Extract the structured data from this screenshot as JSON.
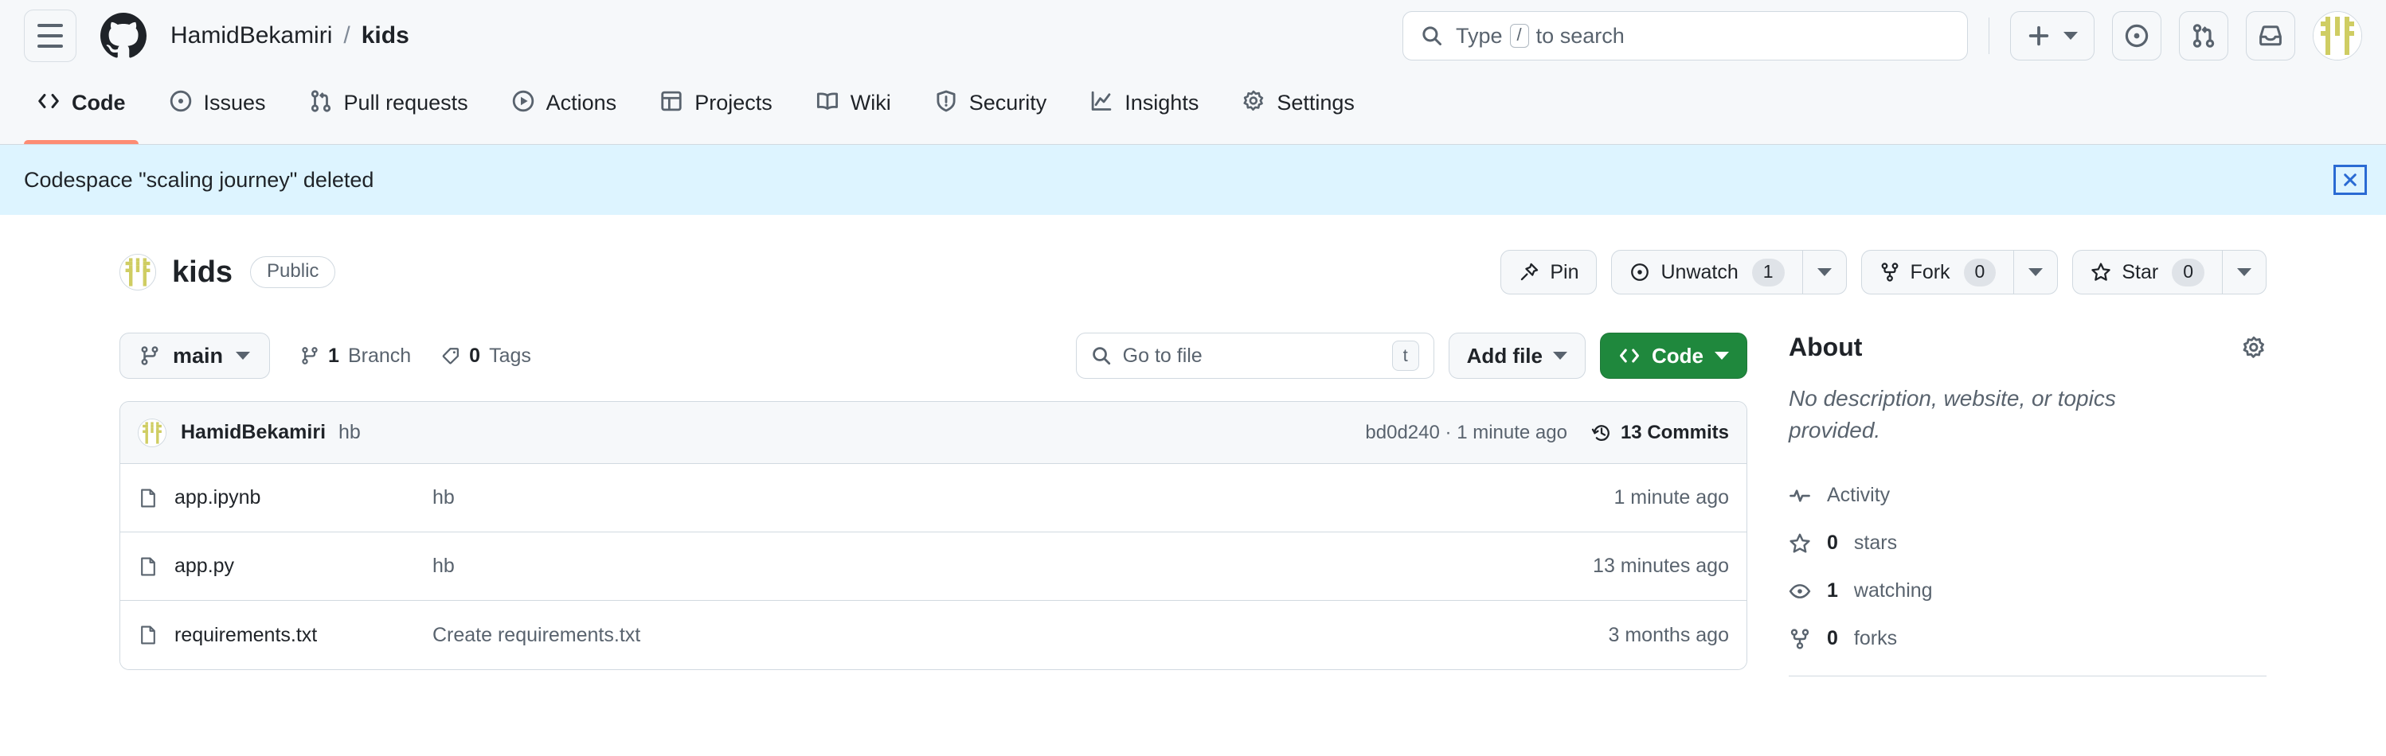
{
  "header": {
    "menu_label": "Open global navigation menu",
    "logo_name": "github-logo",
    "owner": "HamidBekamiri",
    "separator": "/",
    "repo": "kids",
    "search": {
      "placeholder_prefix": "Type",
      "slash_key": "/",
      "placeholder_suffix": "to search"
    },
    "create_new_label": "+",
    "icons": {
      "issues": "issue-opened-icon",
      "pull_requests": "git-pull-request-icon",
      "inbox": "inbox-icon",
      "avatar": "user-avatar"
    }
  },
  "nav": {
    "tabs": [
      {
        "label": "Code",
        "icon": "code-icon",
        "active": true
      },
      {
        "label": "Issues",
        "icon": "issue-opened-icon",
        "active": false
      },
      {
        "label": "Pull requests",
        "icon": "git-pull-request-icon",
        "active": false
      },
      {
        "label": "Actions",
        "icon": "play-icon",
        "active": false
      },
      {
        "label": "Projects",
        "icon": "table-icon",
        "active": false
      },
      {
        "label": "Wiki",
        "icon": "book-icon",
        "active": false
      },
      {
        "label": "Security",
        "icon": "shield-icon",
        "active": false
      },
      {
        "label": "Insights",
        "icon": "graph-icon",
        "active": false
      },
      {
        "label": "Settings",
        "icon": "gear-icon",
        "active": false
      }
    ]
  },
  "banner": {
    "message": "Codespace \"scaling journey\" deleted",
    "close_label": "Dismiss",
    "background": "#ddf4ff",
    "close_border": "#2a6ad3"
  },
  "repo": {
    "name": "kids",
    "visibility": "Public",
    "actions": {
      "pin": "Pin",
      "watch": "Unwatch",
      "watch_count": "1",
      "fork": "Fork",
      "fork_count": "0",
      "star": "Star",
      "star_count": "0"
    }
  },
  "toolbar": {
    "branch": "main",
    "branch_count": "1",
    "branch_word": "Branch",
    "tag_count": "0",
    "tag_word": "Tags",
    "go_to_file_placeholder": "Go to file",
    "go_to_file_key": "t",
    "add_file": "Add file",
    "code_button": "Code",
    "code_color": "#1f883d"
  },
  "commit_bar": {
    "author": "HamidBekamiri",
    "message": "hb",
    "sha": "bd0d240",
    "separator": "·",
    "age": "1 minute ago",
    "commits_count": "13 Commits"
  },
  "files": [
    {
      "name": "app.ipynb",
      "icon": "file-icon",
      "message": "hb",
      "age": "1 minute ago"
    },
    {
      "name": "app.py",
      "icon": "file-icon",
      "message": "hb",
      "age": "13 minutes ago"
    },
    {
      "name": "requirements.txt",
      "icon": "file-icon",
      "message": "Create requirements.txt",
      "age": "3 months ago"
    }
  ],
  "about": {
    "title": "About",
    "gear_label": "Edit repository metadata",
    "description": "No description, website, or topics provided.",
    "stats": [
      {
        "icon": "pulse-icon",
        "value": "",
        "label": "Activity"
      },
      {
        "icon": "star-icon",
        "value": "0",
        "label": "stars"
      },
      {
        "icon": "eye-icon",
        "value": "1",
        "label": "watching"
      },
      {
        "icon": "fork-icon",
        "value": "0",
        "label": "forks"
      }
    ]
  }
}
